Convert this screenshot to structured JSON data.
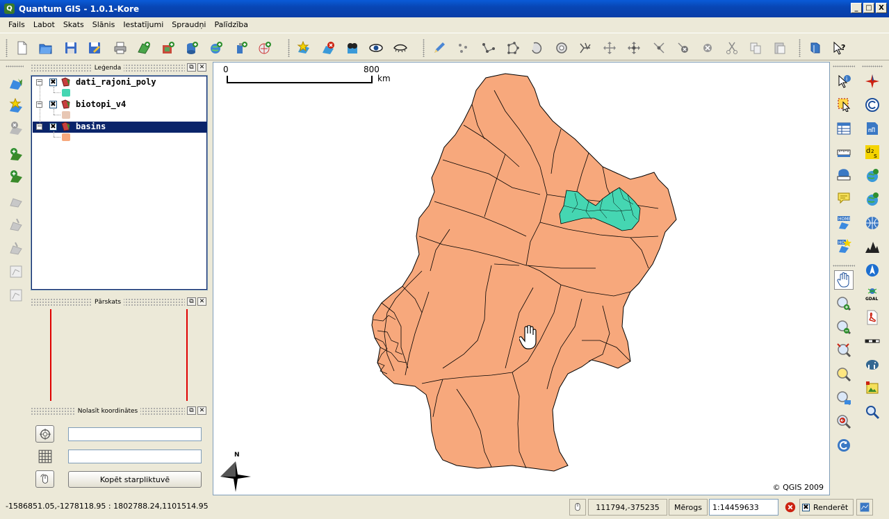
{
  "window": {
    "title": "Quantum GIS - 1.0.1-Kore",
    "app_icon_letter": "Q",
    "minimize": "_",
    "maximize": "□",
    "close": "X"
  },
  "menu": [
    "Fails",
    "Labot",
    "Skats",
    "Slānis",
    "Iestatījumi",
    "Spraudņi",
    "Palīdzība"
  ],
  "toolbar": {
    "icons": [
      "new-project-icon",
      "open-project-icon",
      "save-project-icon",
      "save-as-icon",
      "print-icon",
      "add-vector-layer-icon",
      "add-raster-layer-icon",
      "add-postgis-layer-icon",
      "add-wms-layer-icon",
      "add-wfs-layer-icon",
      "add-spatialite-icon",
      "new-bookmark-icon",
      "remove-layer-icon",
      "overview-add-icon",
      "show-all-layers-icon",
      "hide-all-layers-icon",
      "toggle-editing-icon",
      "capture-point-icon",
      "capture-line-icon",
      "capture-polygon-icon",
      "move-feature-icon",
      "add-ring-icon",
      "split-feature-icon",
      "move-vertex-icon",
      "add-vertex-icon",
      "delete-vertex-icon",
      "delete-selected-icon",
      "cut-features-icon",
      "copy-features-icon",
      "paste-features-icon",
      "help-book-icon",
      "whats-this-icon"
    ]
  },
  "legend_panel": {
    "title": "Leģenda",
    "layers": [
      {
        "name": "dati_rajoni_poly",
        "checked": "✖",
        "swatch_color": "#45d6b2"
      },
      {
        "name": "biotopi_v4",
        "checked": "✖",
        "swatch_color": "#e8c7b4"
      },
      {
        "name": "basins",
        "checked": "✖",
        "swatch_color": "#f7a87c",
        "selected": true
      }
    ]
  },
  "overview_panel": {
    "title": "Pārskats"
  },
  "coords_panel": {
    "title": "Nolasīt koordinātes",
    "input1_value": "",
    "input2_value": "",
    "copy_button": "Kopēt starpliktuvē"
  },
  "map": {
    "scalebar_start": "0",
    "scalebar_end": "800",
    "scalebar_unit": "km",
    "north_label": "N",
    "copyright": "© QGIS 2009",
    "basin_color": "#f7a87c",
    "rajoni_color": "#45d6b2"
  },
  "statusbar": {
    "extents": "-1586851.05,-1278118.95 : 1802788.24,1101514.95",
    "coordinate": "111794,-375235",
    "scale_label": "Mērogs",
    "scale_value": "1:14459633",
    "render_label": "Renderēt",
    "render_checked": "✖"
  }
}
